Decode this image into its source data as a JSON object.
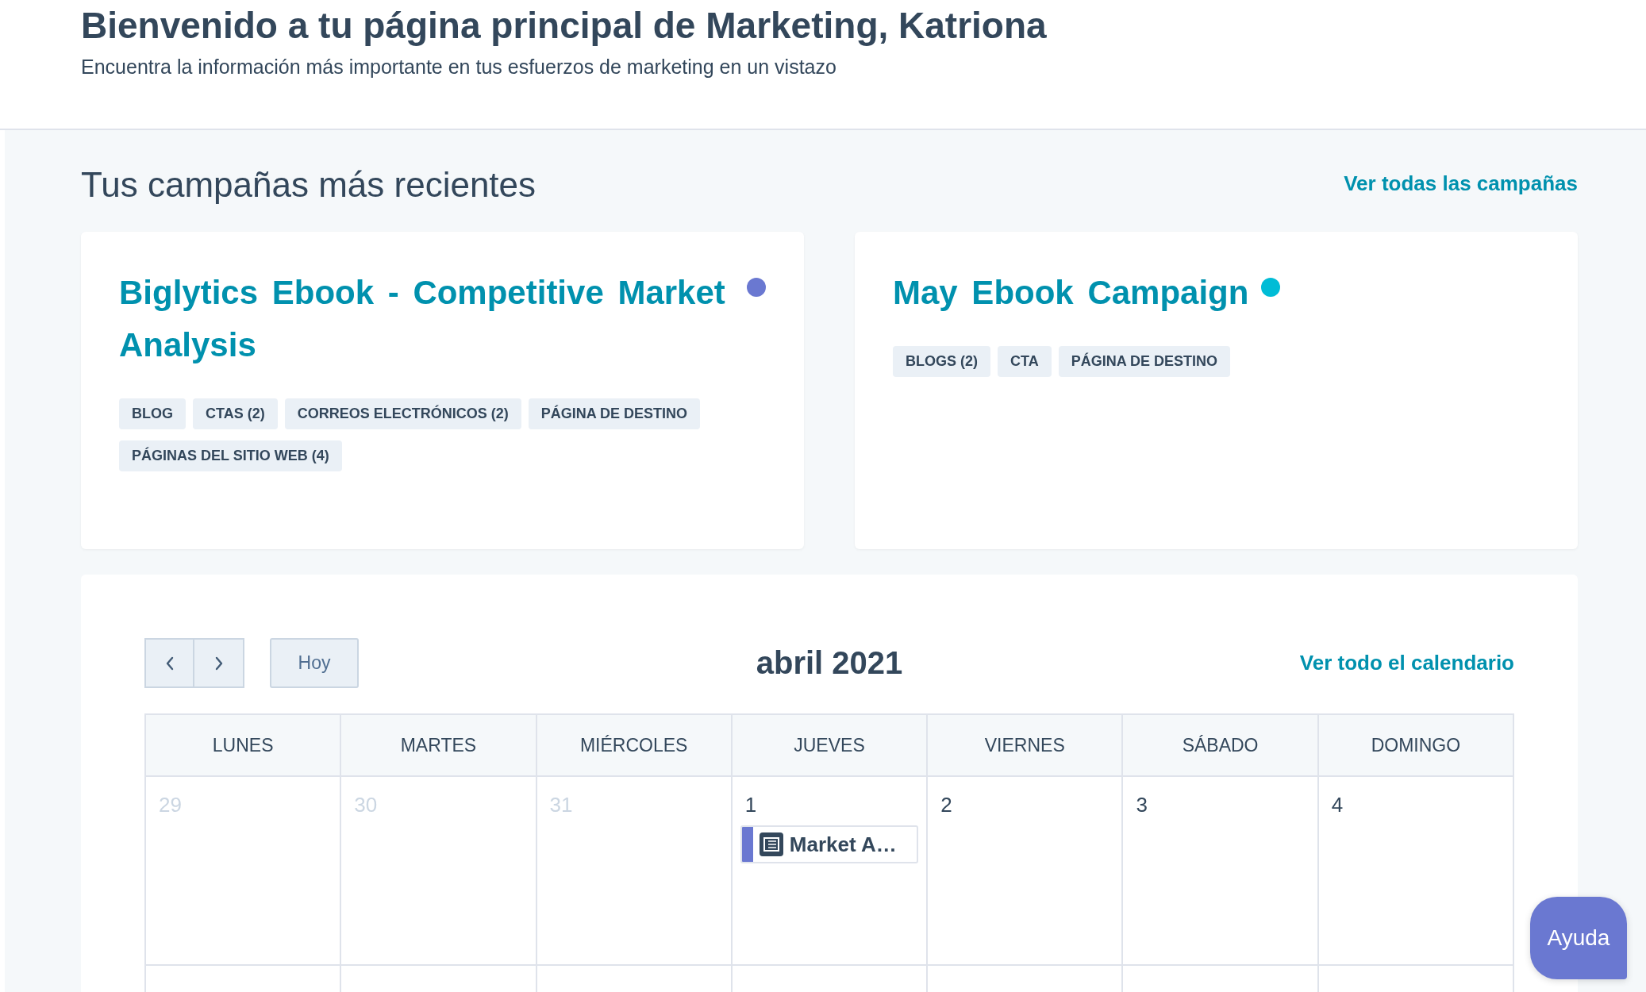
{
  "header": {
    "title": "Bienvenido a tu página principal de Marketing, Katriona",
    "subtitle": "Encuentra la información más importante en tus esfuerzos de marketing en un vistazo"
  },
  "campaigns": {
    "title": "Tus campañas más recientes",
    "link": "Ver todas las campañas",
    "cards": [
      {
        "title": "Biglytics Ebook - Competitive Market Analysis",
        "color": "#6a78d1",
        "tags": [
          "BLOG",
          "CTAS (2)",
          "CORREOS ELECTRÓNICOS (2)",
          "PÁGINA DE DESTINO",
          "PÁGINAS DEL SITIO WEB (4)"
        ]
      },
      {
        "title": "May Ebook Campaign",
        "color": "#00bcd6",
        "tags": [
          "BLOGS (2)",
          "CTA",
          "PÁGINA DE DESTINO"
        ]
      }
    ]
  },
  "calendar": {
    "month": "abril 2021",
    "today_button": "Hoy",
    "link": "Ver todo el calendario",
    "weekdays": [
      "LUNES",
      "MARTES",
      "MIÉRCOLES",
      "JUEVES",
      "VIERNES",
      "SÁBADO",
      "DOMINGO"
    ],
    "days": [
      {
        "day": "29",
        "muted": true
      },
      {
        "day": "30",
        "muted": true
      },
      {
        "day": "31",
        "muted": true
      },
      {
        "day": "1",
        "muted": false,
        "events": [
          {
            "title": "Market A…",
            "color": "#6a78d1"
          }
        ]
      },
      {
        "day": "2",
        "muted": false
      },
      {
        "day": "3",
        "muted": false
      },
      {
        "day": "4",
        "muted": false
      }
    ]
  },
  "help_button": "Ayuda"
}
